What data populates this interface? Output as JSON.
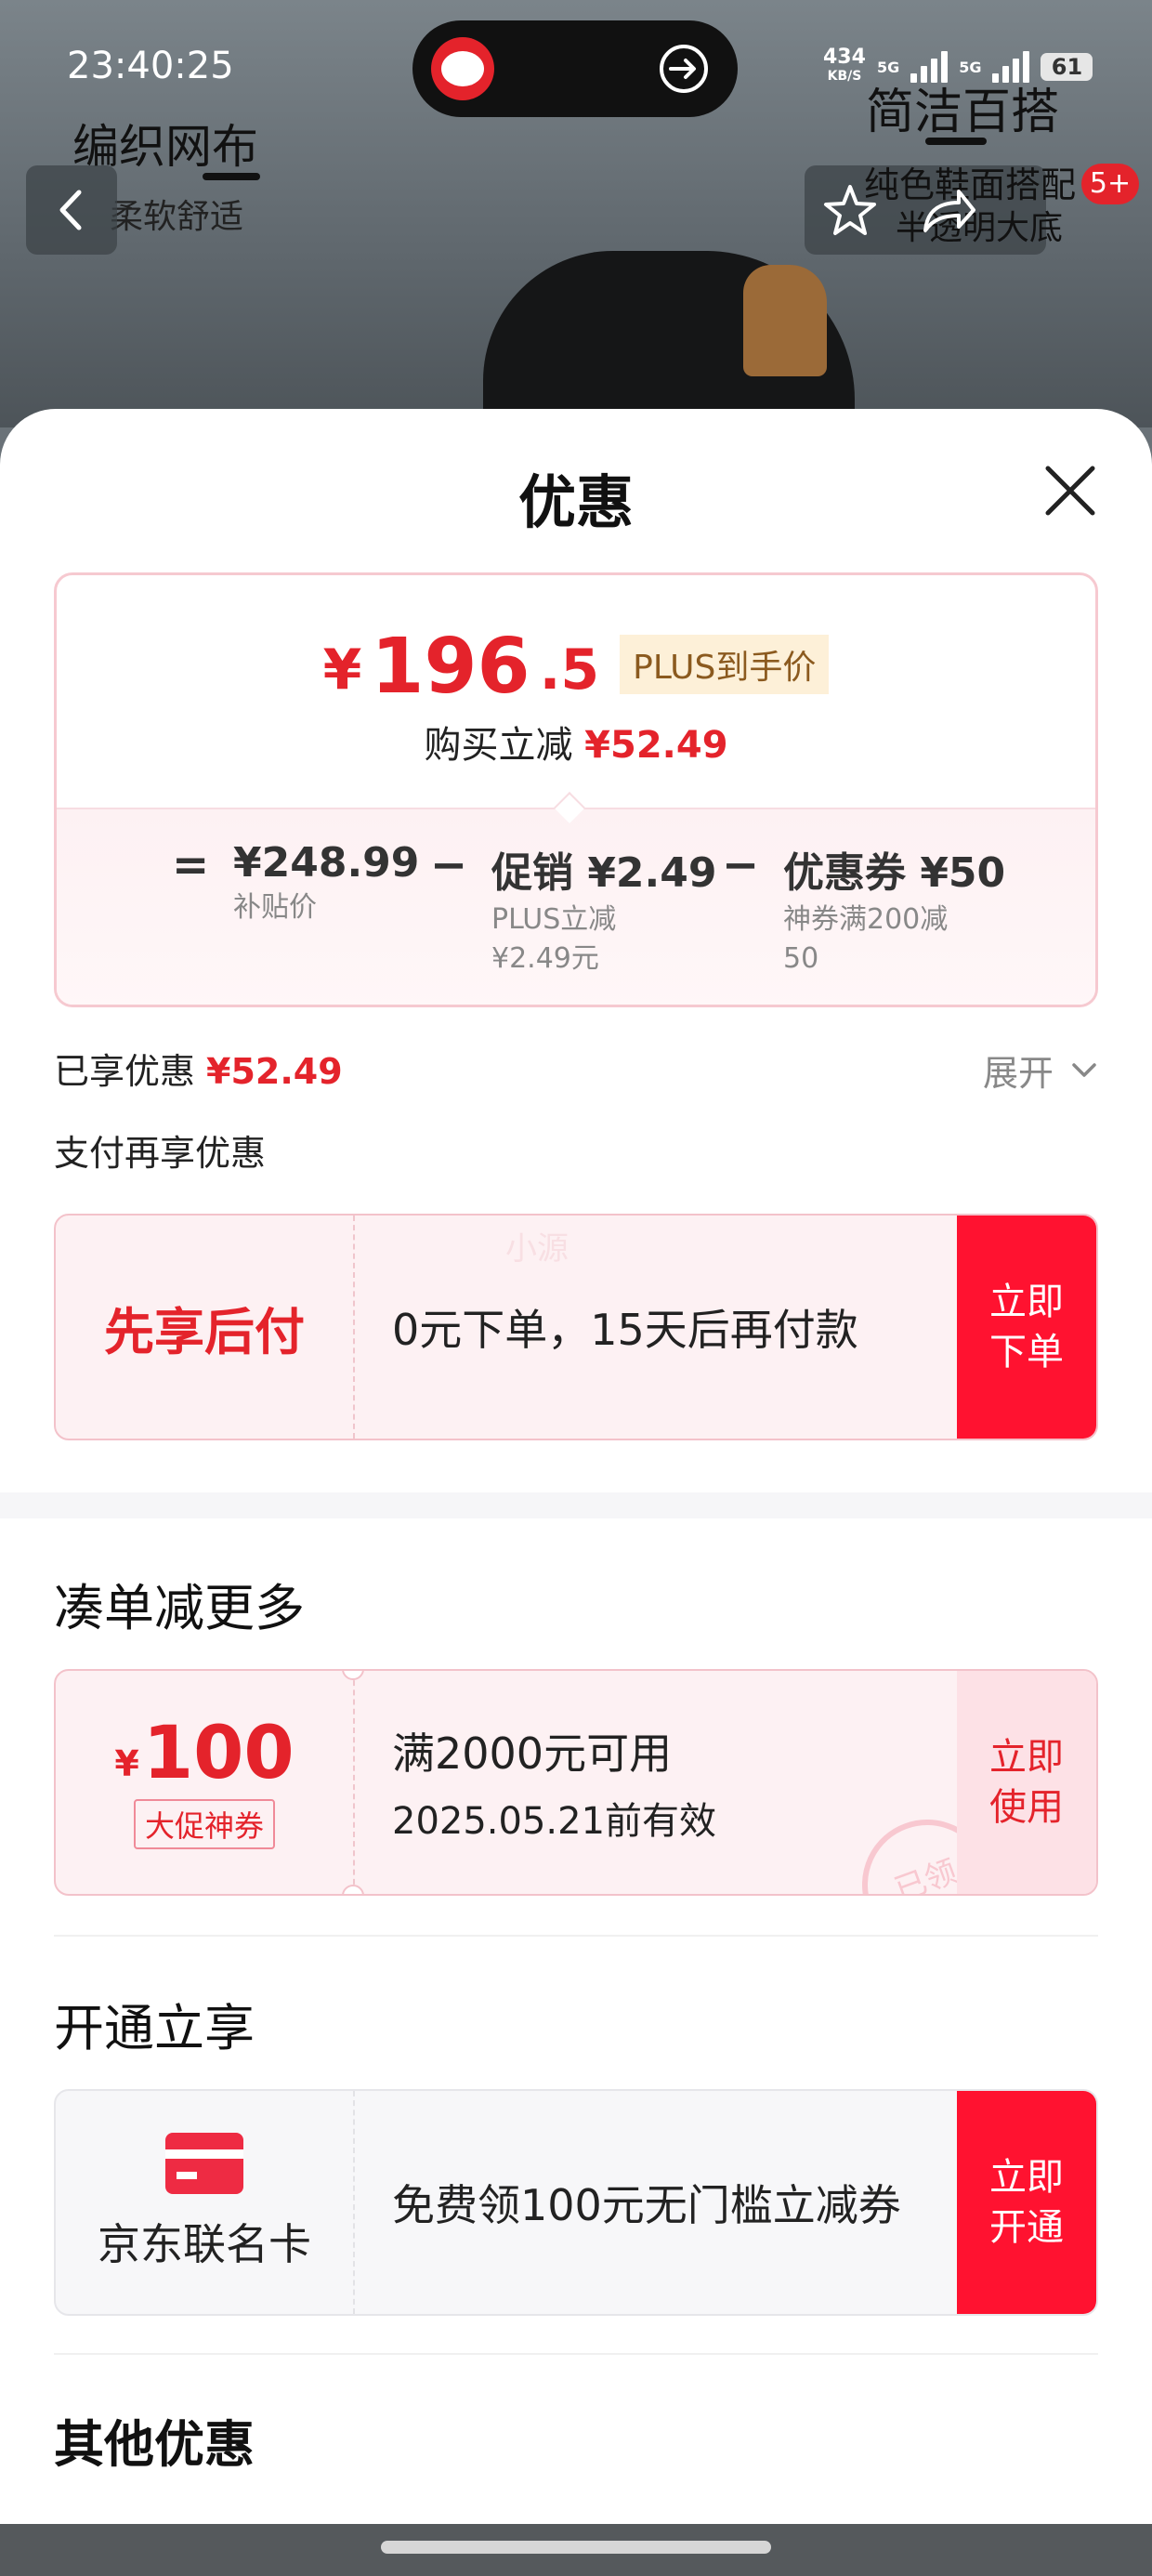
{
  "status_bar": {
    "time": "23:40:25",
    "net_speed_value": "434",
    "net_speed_unit": "KB/S",
    "sim1_label": "5G",
    "sim2_label": "5G",
    "battery": "61"
  },
  "product_header": {
    "left_tab_title": "编织网布",
    "left_tab_subtitle": "柔软舒适",
    "right_tab_title": "简洁百搭",
    "right_tab_subtitle_line1": "纯色鞋面搭配",
    "right_tab_subtitle_line2": "半透明大底",
    "notification_badge": "5+"
  },
  "sheet": {
    "title": "优惠"
  },
  "price_summary": {
    "currency": "¥",
    "final_price_int": "196",
    "final_price_dec": ".5",
    "plus_tag": "PLUS到手价",
    "reduce_label": "购买立减",
    "reduce_amount": "¥52.49",
    "formula": {
      "eq_sign": "=",
      "minus_sign": "−",
      "base_price": "¥248.99",
      "base_label": "补贴价",
      "promo_main": "促销 ¥2.49",
      "promo_sub_line1": "PLUS立减",
      "promo_sub_line2": "¥2.49元",
      "coupon_main": "优惠券 ¥50",
      "coupon_sub_line1": "神券满200减",
      "coupon_sub_line2": "50"
    }
  },
  "enjoyed": {
    "label": "已享优惠",
    "amount": "¥52.49",
    "expand_label": "展开"
  },
  "pay_section": {
    "hint": "支付再享优惠",
    "bnpl_title": "先享后付",
    "bnpl_text": "0元下单，15天后再付款",
    "bnpl_button_line1": "立即",
    "bnpl_button_line2": "下单",
    "watermark": "小源"
  },
  "bundle_section": {
    "title": "凑单减更多",
    "coupon_symbol": "¥",
    "coupon_value": "100",
    "coupon_tag": "大促神券",
    "coupon_condition": "满2000元可用",
    "coupon_expiry": "2025.05.21前有效",
    "coupon_button_line1": "立即",
    "coupon_button_line2": "使用",
    "stamp_text": "已领"
  },
  "open_section": {
    "title": "开通立享",
    "card_name": "京东联名卡",
    "card_text": "免费领100元无门槛立减券",
    "card_button_line1": "立即",
    "card_button_line2": "开通"
  },
  "other_section": {
    "title": "其他优惠"
  },
  "colors": {
    "accent_red": "#e4232b",
    "button_red": "#ff1230",
    "plus_gold": "#8b5a1f"
  }
}
